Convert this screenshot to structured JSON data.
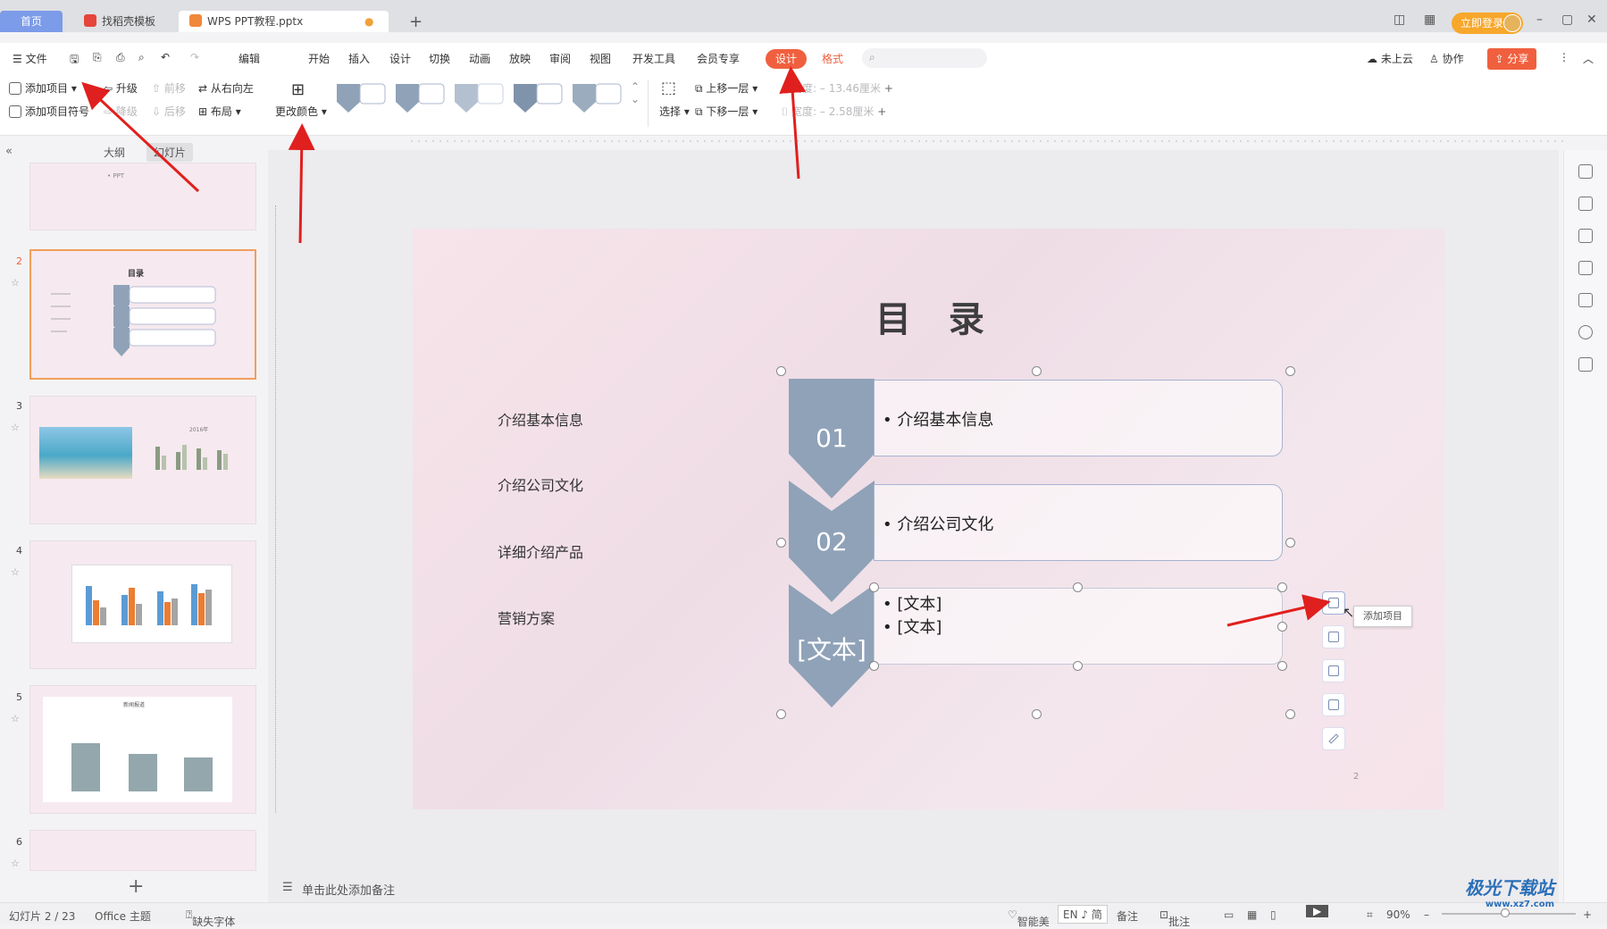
{
  "tabs": {
    "home": "首页",
    "template": "找稻壳模板",
    "doc": "WPS PPT教程.pptx"
  },
  "titlebar": {
    "login": "立即登录"
  },
  "menu": {
    "file": "文件",
    "edit": "编辑",
    "start": "开始",
    "insert": "插入",
    "design_menu": "设计",
    "transition": "切换",
    "animation": "动画",
    "slideshow": "放映",
    "review": "审阅",
    "view": "视图",
    "devtools": "开发工具",
    "vip": "会员专享",
    "design_tab": "设计",
    "format_tab": "格式",
    "cloud": "未上云",
    "collab": "协作",
    "share": "分享"
  },
  "ribbon": {
    "add_item": "添加项目",
    "add_bullet": "添加项目符号",
    "promote": "升级",
    "demote": "降级",
    "move_forward": "前移",
    "move_back": "后移",
    "rtl": "从右向左",
    "layout": "布局",
    "change_color": "更改颜色",
    "select": "选择",
    "bring_up": "上移一层",
    "send_down": "下移一层",
    "height_label": "高度:",
    "height_value": "13.46厘米",
    "width_label": "宽度:",
    "width_value": "2.58厘米"
  },
  "panel": {
    "outline": "大纲",
    "slides": "幻灯片"
  },
  "slides": [
    {
      "num": "",
      "active": false
    },
    {
      "num": "2",
      "active": true
    },
    {
      "num": "3",
      "active": false
    },
    {
      "num": "4",
      "active": false
    },
    {
      "num": "5",
      "active": false
    },
    {
      "num": "6",
      "active": false
    }
  ],
  "thumb_titles": {
    "s1": "• PPT",
    "s2": "目录",
    "s3": "2016年",
    "s5": "新闻报道"
  },
  "slide": {
    "title": "目 录",
    "left_labels": [
      "介绍基本信息",
      "介绍公司文化",
      "详细介绍产品",
      "营销方案"
    ],
    "nums": [
      "01",
      "02",
      "[文本]"
    ],
    "box1": "• 介绍基本信息",
    "box2": "• 介绍公司文化",
    "box3_line1": "• [文本]",
    "box3_line2": "• [文本]",
    "page": "2"
  },
  "tooltip": "添加项目",
  "notes": "单击此处添加备注",
  "status": {
    "slide_count": "幻灯片 2 / 23",
    "theme": "Office 主题",
    "missing_font": "缺失字体",
    "smart": "智能美",
    "ime": "EN ♪ 简",
    "notes_btn": "备注",
    "comments": "批注",
    "zoom": "90%"
  },
  "watermark": {
    "main": "极光下载站",
    "url": "www.xz7.com"
  },
  "colors": {
    "accent": "#f0603f",
    "chevron": "#8fa2b8",
    "selection": "#f29e5b",
    "arrow": "#e0201e"
  }
}
